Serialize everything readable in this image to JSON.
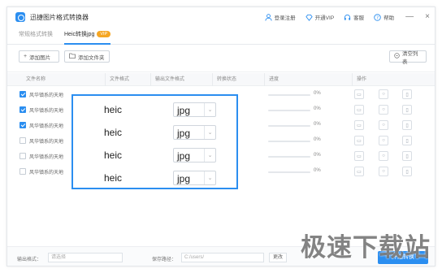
{
  "app": {
    "title": "迅捷图片格式转换器",
    "logo_icon": "app-logo-icon"
  },
  "header": {
    "login_label": "登录注册",
    "vip_label": "开通VIP",
    "service_label": "客服",
    "help_label": "帮助",
    "minimize_glyph": "—",
    "close_glyph": "×"
  },
  "tabs": [
    {
      "label": "常规格式转换",
      "active": false
    },
    {
      "label": "Heic转换jpg",
      "badge": "VIP",
      "active": true
    }
  ],
  "toolbar": {
    "add_image_label": "添加图片",
    "add_folder_label": "添加文件夹",
    "clear_list_label": "清空列表"
  },
  "table": {
    "columns": [
      "文件名称",
      "文件格式",
      "输出文件格式",
      "转换状态",
      "进度",
      "操作"
    ],
    "rows": [
      {
        "name": "风华镇系的天地",
        "checked": true,
        "progress": "0%"
      },
      {
        "name": "风华镇系的天地",
        "checked": true,
        "progress": "0%"
      },
      {
        "name": "风华镇系的天地",
        "checked": true,
        "progress": "0%"
      },
      {
        "name": "风华镇系的天地",
        "checked": false,
        "progress": "0%"
      },
      {
        "name": "风华镇系的天地",
        "checked": false,
        "progress": "0%"
      },
      {
        "name": "风华镇系的天地",
        "checked": false,
        "progress": "0%"
      }
    ]
  },
  "overlay": {
    "rows": [
      {
        "source": "heic",
        "target": "jpg"
      },
      {
        "source": "heic",
        "target": "jpg"
      },
      {
        "source": "heic",
        "target": "jpg"
      },
      {
        "source": "heic",
        "target": "jpg"
      }
    ]
  },
  "footer": {
    "format_label": "输出格式：",
    "format_placeholder": "请选择",
    "path_label": "保存路径：",
    "path_value": "C:/users/",
    "change_label": "更改",
    "start_label": "开始转换"
  },
  "watermark": "极速下载站",
  "colors": {
    "accent": "#2b8ef0",
    "vip_badge": "#f5a623"
  }
}
